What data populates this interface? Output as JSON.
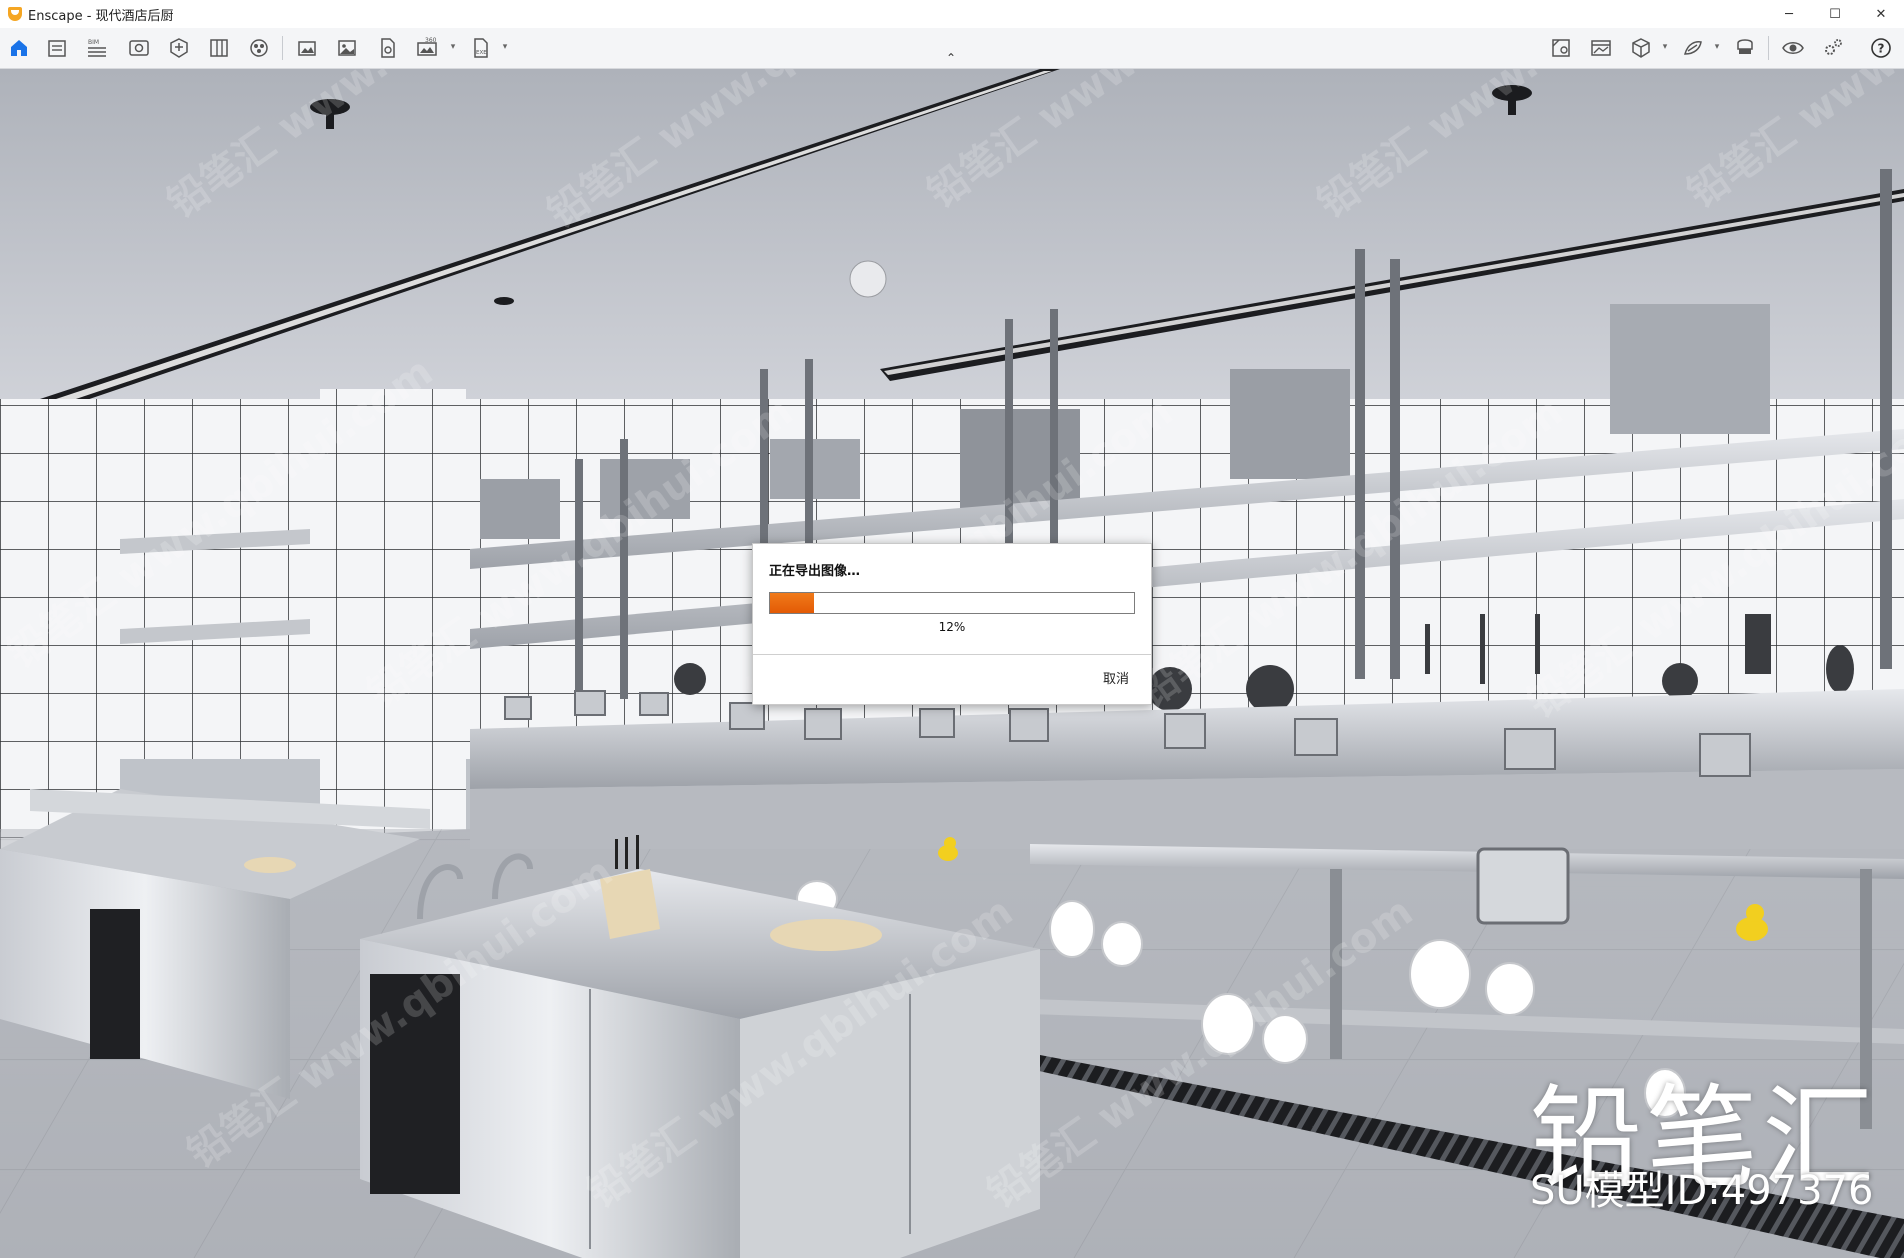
{
  "window": {
    "app_name": "Enscape",
    "title": "Enscape - 现代酒店后厨",
    "controls": {
      "minimize": "─",
      "maximize": "☐",
      "close": "✕"
    }
  },
  "toolbar": {
    "left_icons": [
      "home-icon",
      "project-info-icon",
      "bim-icon",
      "visual-settings-icon",
      "asset-library-icon",
      "materials-icon",
      "sphere-icon",
      "screenshot-icon",
      "export-image-icon",
      "batch-render-icon",
      "panorama-360-icon",
      "exe-export-icon"
    ],
    "bim_label": "BIM",
    "badge_360": "360",
    "exe_label": "EXE",
    "right_icons": [
      "view-management-icon",
      "video-editor-icon",
      "cube-icon",
      "material-editor-icon",
      "vr-headset-icon",
      "visibility-icon",
      "settings-icon",
      "help-icon"
    ],
    "help_glyph": "?",
    "collapse_glyph": "⌃"
  },
  "dialog": {
    "title": "正在导出图像…",
    "progress_value": 12,
    "progress_text": "12%",
    "cancel_label": "取消"
  },
  "watermark": {
    "brand": "铅笔汇",
    "model_id": "SU模型ID:497376"
  },
  "colors": {
    "accent": "#1a73e8",
    "progress": "#e8660c",
    "app_icon": "#f5a623"
  }
}
